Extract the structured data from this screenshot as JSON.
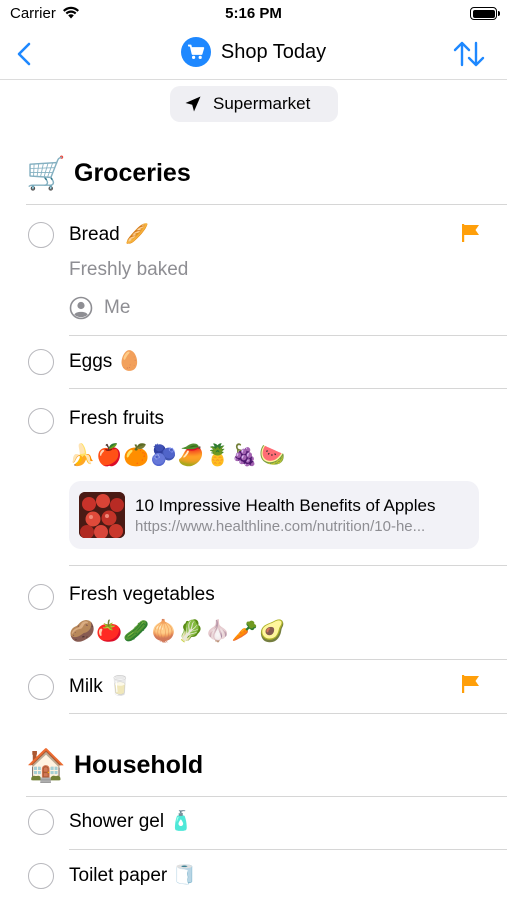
{
  "status_bar": {
    "carrier": "Carrier",
    "time": "5:16 PM"
  },
  "nav": {
    "title": "Shop Today"
  },
  "location_chip": {
    "label": "Supermarket"
  },
  "colors": {
    "accent": "#1e88ff",
    "flag": "#ff9f0a",
    "secondary_text": "#8e8e93"
  },
  "sections": [
    {
      "emoji": "🛒",
      "title": "Groceries",
      "items": [
        {
          "title": "Bread 🥖",
          "flagged": true,
          "note": "Freshly baked",
          "assignee": "Me"
        },
        {
          "title": "Eggs 🥚",
          "flagged": false
        },
        {
          "title": "Fresh fruits",
          "flagged": false,
          "emojis": "🍌🍎🍊🫐🥭🍍🍇🍉",
          "link": {
            "title": "10 Impressive Health Benefits of Apples",
            "url": "https://www.healthline.com/nutrition/10-he..."
          }
        },
        {
          "title": "Fresh vegetables",
          "flagged": false,
          "emojis": "🥔🍅🥒🧅🥬🧄🥕🥑"
        },
        {
          "title": "Milk 🥛",
          "flagged": true
        }
      ]
    },
    {
      "emoji": "🏠",
      "title": "Household",
      "items": [
        {
          "title": "Shower gel 🧴",
          "flagged": false
        },
        {
          "title": "Toilet paper 🧻",
          "flagged": false
        }
      ]
    }
  ]
}
